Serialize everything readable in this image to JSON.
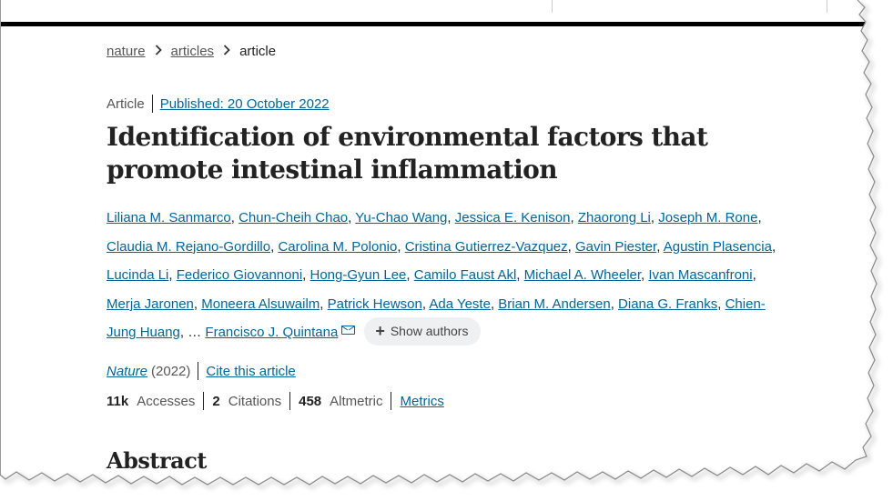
{
  "breadcrumb": {
    "items": [
      "nature",
      "articles"
    ],
    "current": "article"
  },
  "meta": {
    "type": "Article",
    "published": "Published: 20 October 2022"
  },
  "title": "Identification of environmental factors that promote intestinal inflammation",
  "authors": [
    "Liliana M. Sanmarco",
    "Chun-Cheih Chao",
    "Yu-Chao Wang",
    "Jessica E. Kenison",
    "Zhaorong Li",
    "Joseph M. Rone",
    "Claudia M. Rejano-Gordillo",
    "Carolina M. Polonio",
    "Cristina Gutierrez-Vazquez",
    "Gavin Piester",
    "Agustin Plasencia",
    "Lucinda Li",
    "Federico Giovannoni",
    "Hong-Gyun Lee",
    "Camilo Faust Akl",
    "Michael A. Wheeler",
    "Ivan Mascanfroni",
    "Merja Jaronen",
    "Moneera Alsuwailm",
    "Patrick Hewson",
    "Ada Yeste",
    "Brian M. Andersen",
    "Diana G. Franks",
    "Chien-Jung Huang"
  ],
  "ellipsis": "…",
  "last_author": "Francisco J. Quintana",
  "show_authors_label": "Show authors",
  "journal": {
    "name": "Nature",
    "year": "(2022)",
    "cite_label": "Cite this article"
  },
  "metrics": {
    "accesses_value": "11k",
    "accesses_label": "Accesses",
    "citations_value": "2",
    "citations_label": "Citations",
    "altmetric_value": "458",
    "altmetric_label": "Altmetric",
    "metrics_link": "Metrics"
  },
  "abstract_heading": "Abstract",
  "colors": {
    "link": "#006699",
    "text": "#222222",
    "pill_bg": "#eef0f2"
  },
  "icons": [
    "chevron-right-icon",
    "envelope-icon",
    "plus-icon"
  ]
}
